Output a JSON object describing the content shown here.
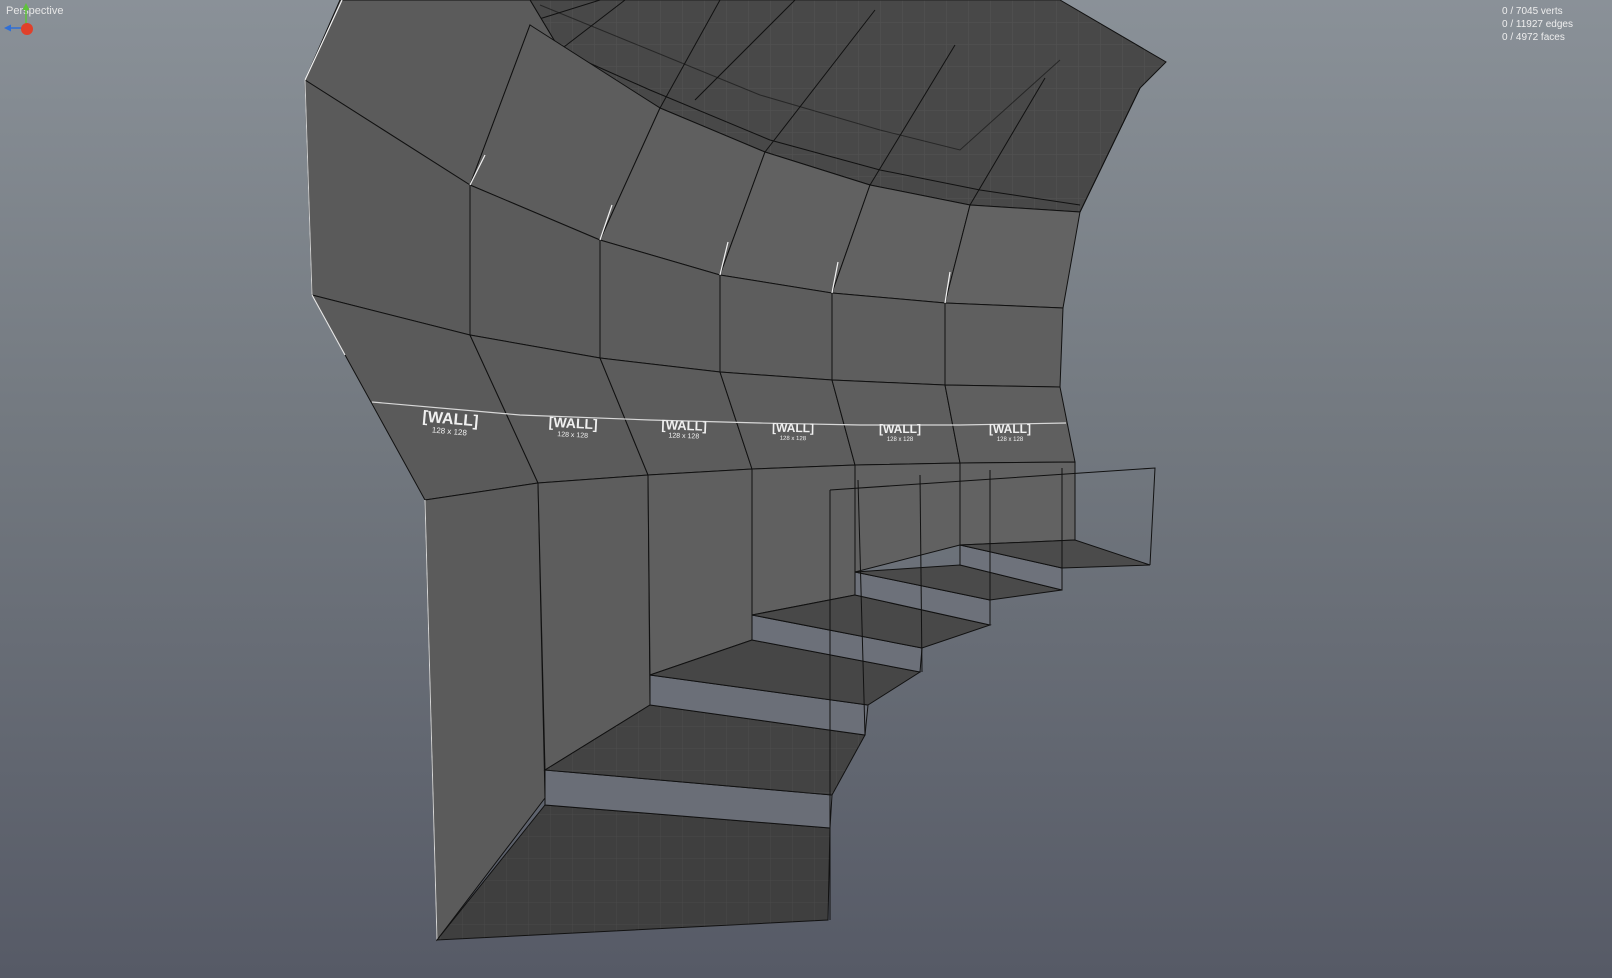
{
  "viewport": {
    "view_name": "Perspective",
    "stats": {
      "verts": "0 / 7045 verts",
      "edges": "0 / 11927 edges",
      "faces": "0 / 4972 faces"
    }
  },
  "texture_labels": [
    {
      "title": "[WALL]",
      "size": "128 x 128"
    },
    {
      "title": "[WALL]",
      "size": "128 x 128"
    },
    {
      "title": "[WALL]",
      "size": "128 x 128"
    },
    {
      "title": "[WALL]",
      "size": "128 x 128"
    },
    {
      "title": "[WALL]",
      "size": "128 x 128"
    },
    {
      "title": "[WALL]",
      "size": "128 x 128"
    }
  ],
  "gizmo": {
    "icon": "axis-gizmo-icon",
    "axis_colors": {
      "x": "#2f6fd6",
      "y": "#5ec23a",
      "z": "#e0402a"
    }
  },
  "colors": {
    "background_top": "#8a9198",
    "background_bottom": "#565a66",
    "face_light": "#5d5d5d",
    "face_dark": "#454545",
    "edge": "#111111",
    "highlight": "#f2f2f2"
  }
}
